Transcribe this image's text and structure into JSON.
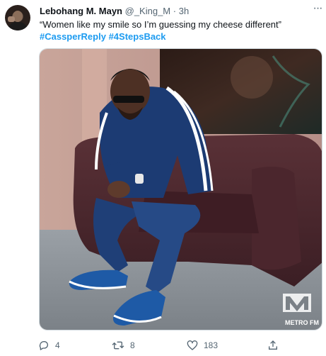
{
  "tweet": {
    "author_name": "Lebohang M. Mayn",
    "author_handle": "@_King_M",
    "separator": "·",
    "time": "3h",
    "text": "“Women like my smile so I’m guessing my cheese different”",
    "hashtags": [
      "#CassperReply",
      "#4StepsBack"
    ],
    "media_watermark": "METRO FM"
  },
  "actions": {
    "reply_count": "4",
    "retweet_count": "8",
    "like_count": "183"
  },
  "icons": {
    "more": "more-horizontal-icon",
    "reply": "reply-icon",
    "retweet": "retweet-icon",
    "like": "heart-icon",
    "share": "share-icon"
  },
  "colors": {
    "link": "#1d9bf0",
    "secondary_text": "#536471",
    "primary_text": "#0f1419"
  }
}
